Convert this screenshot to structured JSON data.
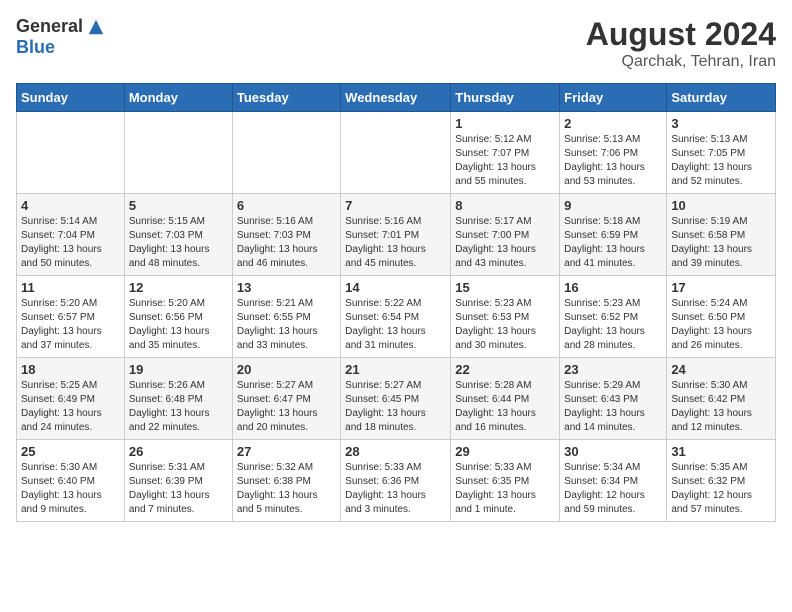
{
  "header": {
    "logo_general": "General",
    "logo_blue": "Blue",
    "month_year": "August 2024",
    "location": "Qarchak, Tehran, Iran"
  },
  "days_of_week": [
    "Sunday",
    "Monday",
    "Tuesday",
    "Wednesday",
    "Thursday",
    "Friday",
    "Saturday"
  ],
  "weeks": [
    [
      {
        "day": "",
        "info": ""
      },
      {
        "day": "",
        "info": ""
      },
      {
        "day": "",
        "info": ""
      },
      {
        "day": "",
        "info": ""
      },
      {
        "day": "1",
        "info": "Sunrise: 5:12 AM\nSunset: 7:07 PM\nDaylight: 13 hours\nand 55 minutes."
      },
      {
        "day": "2",
        "info": "Sunrise: 5:13 AM\nSunset: 7:06 PM\nDaylight: 13 hours\nand 53 minutes."
      },
      {
        "day": "3",
        "info": "Sunrise: 5:13 AM\nSunset: 7:05 PM\nDaylight: 13 hours\nand 52 minutes."
      }
    ],
    [
      {
        "day": "4",
        "info": "Sunrise: 5:14 AM\nSunset: 7:04 PM\nDaylight: 13 hours\nand 50 minutes."
      },
      {
        "day": "5",
        "info": "Sunrise: 5:15 AM\nSunset: 7:03 PM\nDaylight: 13 hours\nand 48 minutes."
      },
      {
        "day": "6",
        "info": "Sunrise: 5:16 AM\nSunset: 7:03 PM\nDaylight: 13 hours\nand 46 minutes."
      },
      {
        "day": "7",
        "info": "Sunrise: 5:16 AM\nSunset: 7:01 PM\nDaylight: 13 hours\nand 45 minutes."
      },
      {
        "day": "8",
        "info": "Sunrise: 5:17 AM\nSunset: 7:00 PM\nDaylight: 13 hours\nand 43 minutes."
      },
      {
        "day": "9",
        "info": "Sunrise: 5:18 AM\nSunset: 6:59 PM\nDaylight: 13 hours\nand 41 minutes."
      },
      {
        "day": "10",
        "info": "Sunrise: 5:19 AM\nSunset: 6:58 PM\nDaylight: 13 hours\nand 39 minutes."
      }
    ],
    [
      {
        "day": "11",
        "info": "Sunrise: 5:20 AM\nSunset: 6:57 PM\nDaylight: 13 hours\nand 37 minutes."
      },
      {
        "day": "12",
        "info": "Sunrise: 5:20 AM\nSunset: 6:56 PM\nDaylight: 13 hours\nand 35 minutes."
      },
      {
        "day": "13",
        "info": "Sunrise: 5:21 AM\nSunset: 6:55 PM\nDaylight: 13 hours\nand 33 minutes."
      },
      {
        "day": "14",
        "info": "Sunrise: 5:22 AM\nSunset: 6:54 PM\nDaylight: 13 hours\nand 31 minutes."
      },
      {
        "day": "15",
        "info": "Sunrise: 5:23 AM\nSunset: 6:53 PM\nDaylight: 13 hours\nand 30 minutes."
      },
      {
        "day": "16",
        "info": "Sunrise: 5:23 AM\nSunset: 6:52 PM\nDaylight: 13 hours\nand 28 minutes."
      },
      {
        "day": "17",
        "info": "Sunrise: 5:24 AM\nSunset: 6:50 PM\nDaylight: 13 hours\nand 26 minutes."
      }
    ],
    [
      {
        "day": "18",
        "info": "Sunrise: 5:25 AM\nSunset: 6:49 PM\nDaylight: 13 hours\nand 24 minutes."
      },
      {
        "day": "19",
        "info": "Sunrise: 5:26 AM\nSunset: 6:48 PM\nDaylight: 13 hours\nand 22 minutes."
      },
      {
        "day": "20",
        "info": "Sunrise: 5:27 AM\nSunset: 6:47 PM\nDaylight: 13 hours\nand 20 minutes."
      },
      {
        "day": "21",
        "info": "Sunrise: 5:27 AM\nSunset: 6:45 PM\nDaylight: 13 hours\nand 18 minutes."
      },
      {
        "day": "22",
        "info": "Sunrise: 5:28 AM\nSunset: 6:44 PM\nDaylight: 13 hours\nand 16 minutes."
      },
      {
        "day": "23",
        "info": "Sunrise: 5:29 AM\nSunset: 6:43 PM\nDaylight: 13 hours\nand 14 minutes."
      },
      {
        "day": "24",
        "info": "Sunrise: 5:30 AM\nSunset: 6:42 PM\nDaylight: 13 hours\nand 12 minutes."
      }
    ],
    [
      {
        "day": "25",
        "info": "Sunrise: 5:30 AM\nSunset: 6:40 PM\nDaylight: 13 hours\nand 9 minutes."
      },
      {
        "day": "26",
        "info": "Sunrise: 5:31 AM\nSunset: 6:39 PM\nDaylight: 13 hours\nand 7 minutes."
      },
      {
        "day": "27",
        "info": "Sunrise: 5:32 AM\nSunset: 6:38 PM\nDaylight: 13 hours\nand 5 minutes."
      },
      {
        "day": "28",
        "info": "Sunrise: 5:33 AM\nSunset: 6:36 PM\nDaylight: 13 hours\nand 3 minutes."
      },
      {
        "day": "29",
        "info": "Sunrise: 5:33 AM\nSunset: 6:35 PM\nDaylight: 13 hours\nand 1 minute."
      },
      {
        "day": "30",
        "info": "Sunrise: 5:34 AM\nSunset: 6:34 PM\nDaylight: 12 hours\nand 59 minutes."
      },
      {
        "day": "31",
        "info": "Sunrise: 5:35 AM\nSunset: 6:32 PM\nDaylight: 12 hours\nand 57 minutes."
      }
    ]
  ]
}
